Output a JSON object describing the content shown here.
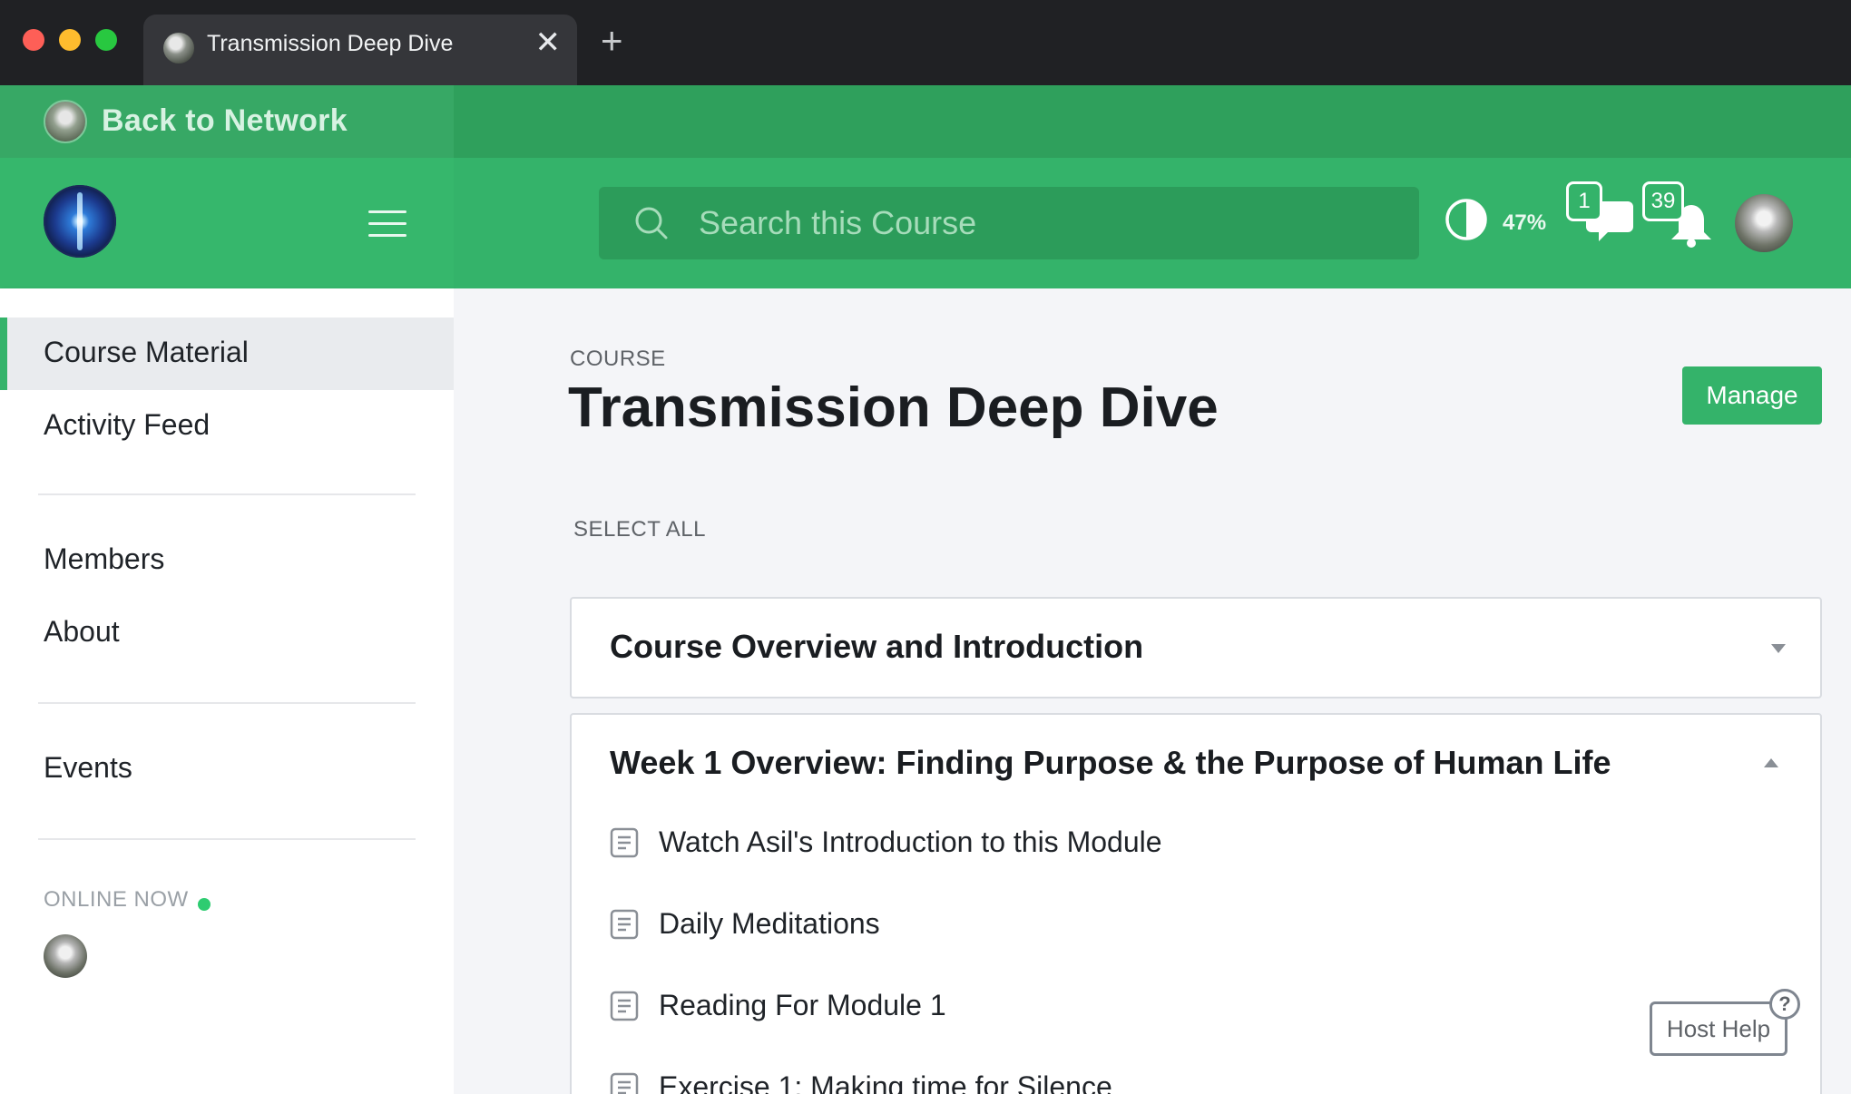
{
  "browser": {
    "tab_title": "Transmission Deep Dive",
    "tab_close": "✕",
    "new_tab": "+"
  },
  "network": {
    "back_label": "Back to Network"
  },
  "header": {
    "search_placeholder": "Search this Course",
    "progress_percent": "47%",
    "progress_value": 0.47,
    "messages_count": "1",
    "notifications_count": "39",
    "accent_color": "#34b36a"
  },
  "sidebar": {
    "items": [
      {
        "label": "Course Material",
        "active": true
      },
      {
        "label": "Activity Feed"
      },
      {
        "label": "Members"
      },
      {
        "label": "About"
      },
      {
        "label": "Events"
      }
    ],
    "online_label": "ONLINE NOW"
  },
  "main": {
    "kicker": "COURSE",
    "title": "Transmission Deep Dive",
    "manage_label": "Manage",
    "select_all": "SELECT ALL",
    "sections": [
      {
        "title": "Course Overview and Introduction",
        "expanded": false
      },
      {
        "title": "Week 1 Overview: Finding Purpose & the Purpose of Human Life",
        "expanded": true,
        "lessons": [
          "Watch Asil's Introduction to this Module",
          "Daily Meditations",
          "Reading For Module 1",
          "Exercise 1: Making time for Silence"
        ]
      }
    ],
    "host_help": "Host Help",
    "help_mark": "?"
  },
  "icons": {
    "tab_favicon": "avatar-icon",
    "search": "search-icon",
    "progress": "half-circle-icon",
    "messages": "chat-bubbles-icon",
    "notifications": "bell-icon",
    "lesson": "document-icon",
    "menu": "hamburger-icon"
  }
}
